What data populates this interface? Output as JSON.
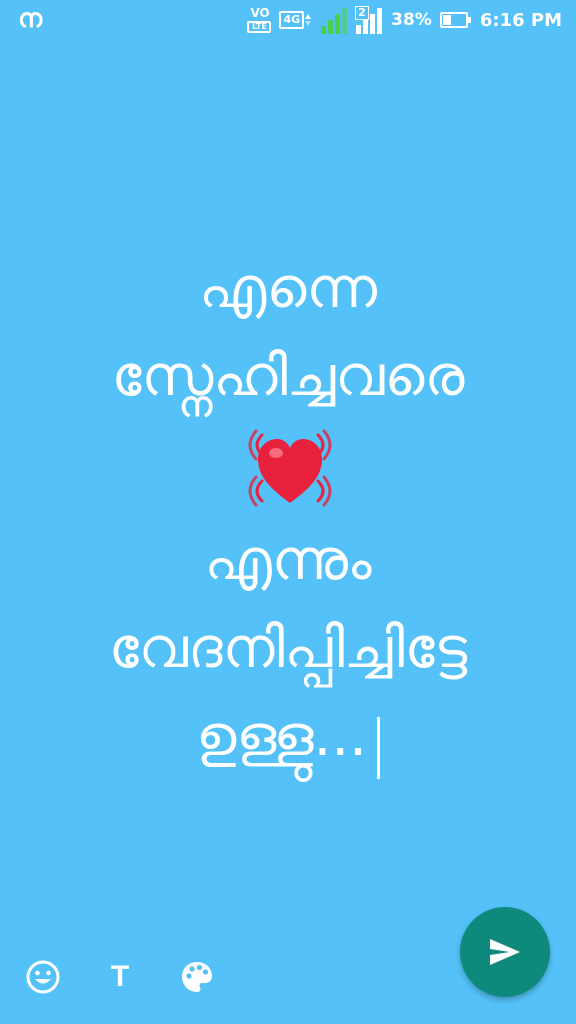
{
  "status_bar": {
    "notification_glyph": "ന",
    "volte_top": "VO",
    "volte_bottom": "LTE",
    "network_type": "4G",
    "sim2_label": "2",
    "battery_percent": "38%",
    "battery_level": 0.38,
    "time": "6:16 PM"
  },
  "status": {
    "line1": "എന്നെ",
    "line2": "സ്നേഹിച്ചവരെ",
    "line3": "എന്നും",
    "line4": "വേദനിപ്പിച്ചിട്ടേ",
    "line5": "ഉള്ളു..."
  },
  "icons": {
    "heart": "vibrating-heart-icon",
    "emoji": "smiley-icon",
    "text": "text-style-icon",
    "palette": "palette-icon",
    "send": "send-icon"
  },
  "toolbar": {
    "text_label": "T"
  },
  "colors": {
    "background": "#54c2f8",
    "fab": "#0e8a7c",
    "heart": "#e8213c",
    "text": "#ffffff"
  }
}
